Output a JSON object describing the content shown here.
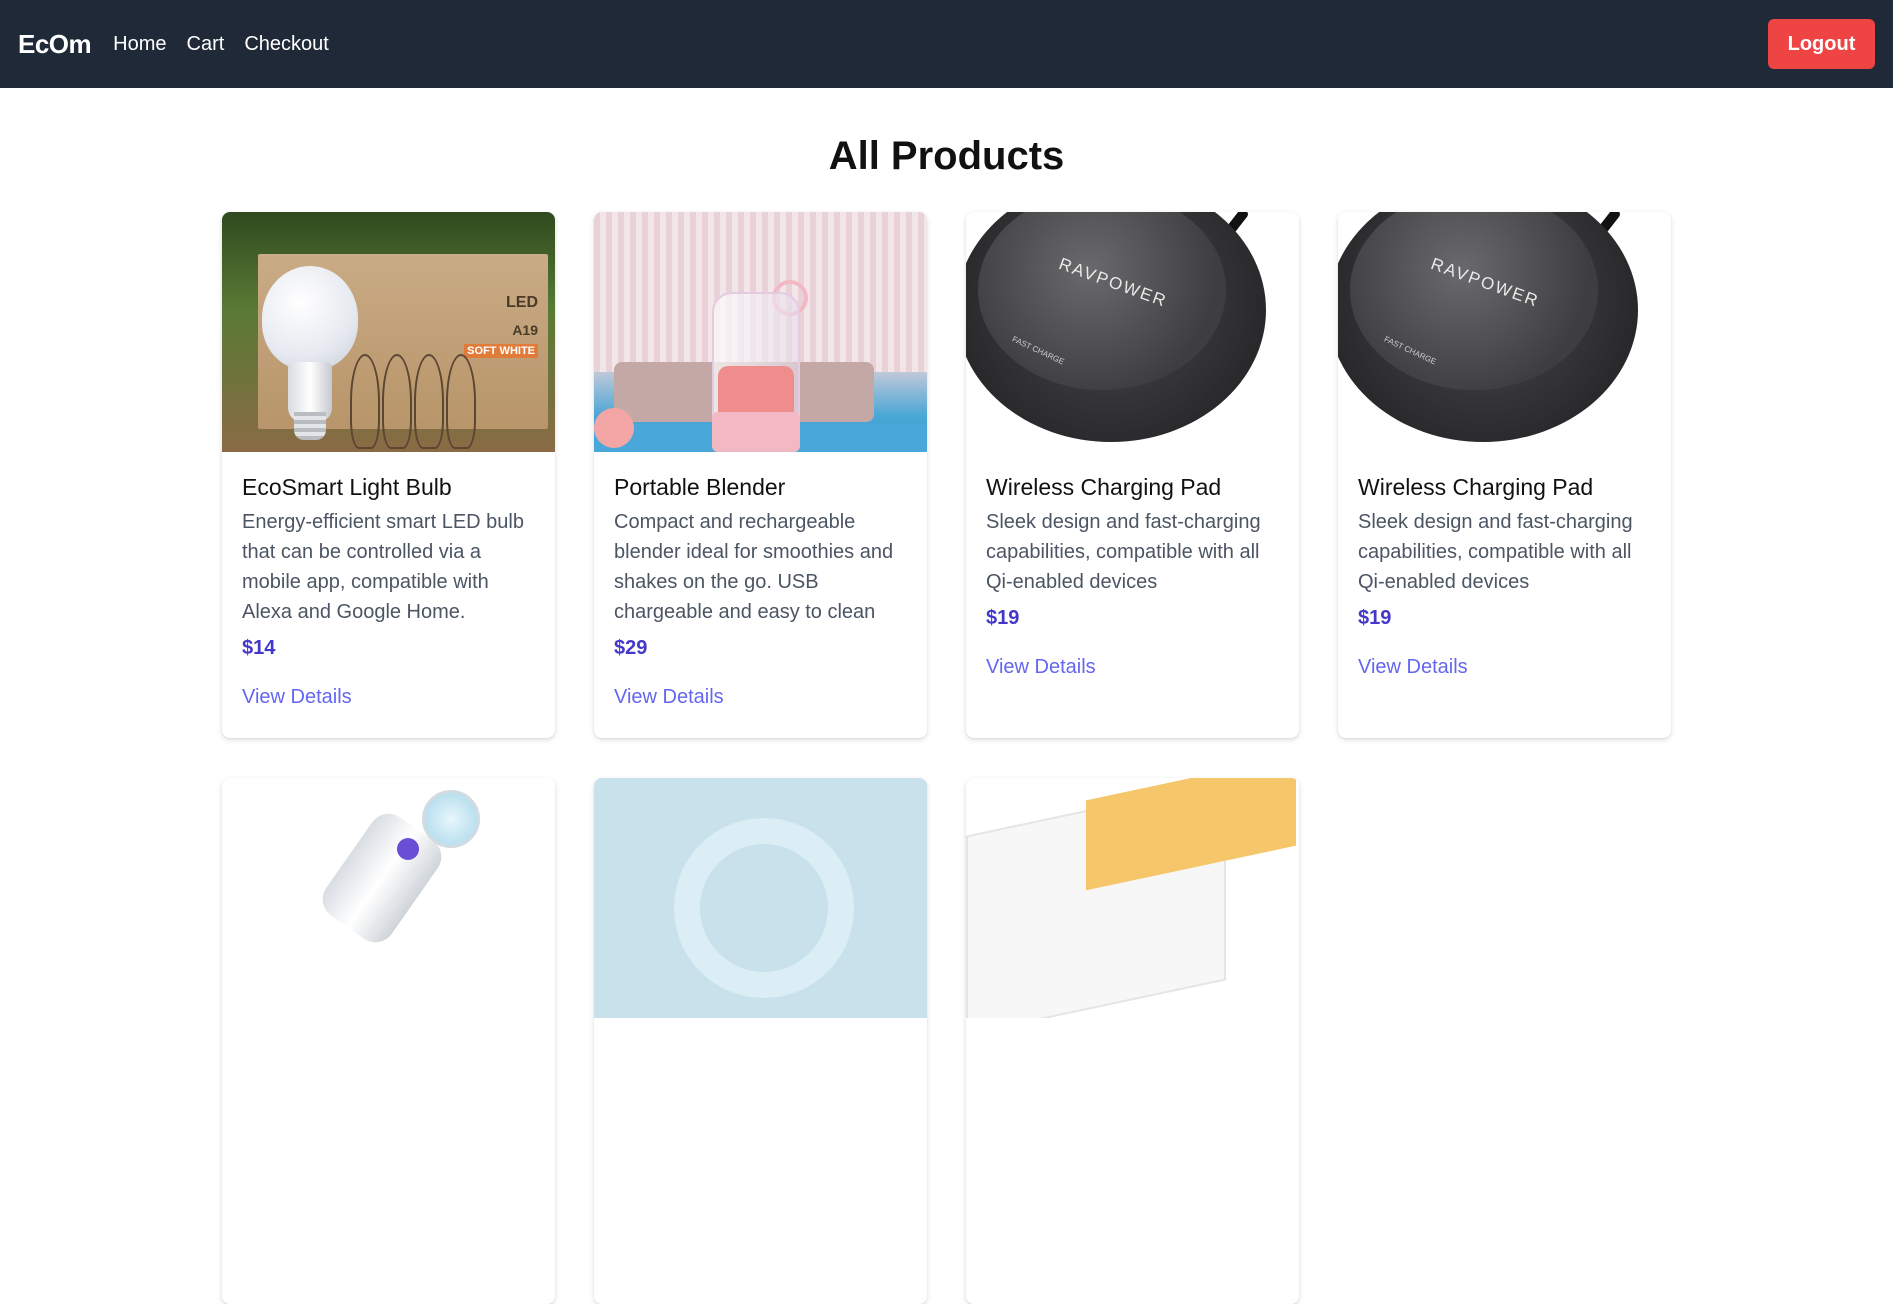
{
  "nav": {
    "brand": "EcOm",
    "links": [
      "Home",
      "Cart",
      "Checkout"
    ],
    "logout_label": "Logout"
  },
  "page": {
    "title": "All Products"
  },
  "products": [
    {
      "title": "EcoSmart Light Bulb",
      "description": "Energy-efficient smart LED bulb that can be controlled via a mobile app, compatible with Alexa and Google Home.",
      "price": "$14",
      "link": "View Details",
      "box_text": [
        "LED",
        "A19",
        "SOFT WHITE"
      ]
    },
    {
      "title": "Portable Blender",
      "description": "Compact and rechargeable blender ideal for smoothies and shakes on the go. USB chargeable and easy to clean",
      "price": "$29",
      "link": "View Details"
    },
    {
      "title": "Wireless Charging Pad",
      "description": "Sleek design and fast-charging capabilities, compatible with all Qi-enabled devices",
      "price": "$19",
      "link": "View Details",
      "pad_brand": "RAVPOWER",
      "pad_fast": "FAST CHARGE"
    },
    {
      "title": "Wireless Charging Pad",
      "description": "Sleek design and fast-charging capabilities, compatible with all Qi-enabled devices",
      "price": "$19",
      "link": "View Details",
      "pad_brand": "RAVPOWER",
      "pad_fast": "FAST CHARGE"
    }
  ],
  "colors": {
    "navbar": "#1f2937",
    "logout": "#ef4444",
    "price": "#4338ca",
    "link": "#6366f1"
  }
}
